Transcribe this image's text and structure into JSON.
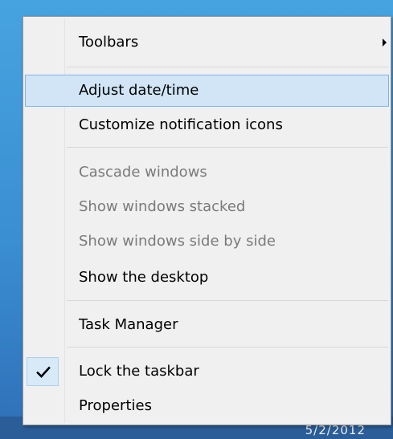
{
  "menu": {
    "items": [
      {
        "label": "Toolbars",
        "state": "normal",
        "submenu": true
      },
      {
        "label": "Adjust date/time",
        "state": "highlighted"
      },
      {
        "label": "Customize notification icons",
        "state": "normal"
      },
      {
        "label": "Cascade windows",
        "state": "disabled"
      },
      {
        "label": "Show windows stacked",
        "state": "disabled"
      },
      {
        "label": "Show windows side by side",
        "state": "disabled"
      },
      {
        "label": "Show the desktop",
        "state": "normal"
      },
      {
        "label": "Task Manager",
        "state": "normal"
      },
      {
        "label": "Lock the taskbar",
        "state": "normal",
        "checked": true
      },
      {
        "label": "Properties",
        "state": "normal"
      }
    ]
  },
  "tray": {
    "date": "5/2/2012"
  },
  "colors": {
    "highlight": "#d1e5f7",
    "highlight_border": "#7eb4ea",
    "disabled_text": "#7a7a7a",
    "menu_bg": "#f0f0f0"
  }
}
